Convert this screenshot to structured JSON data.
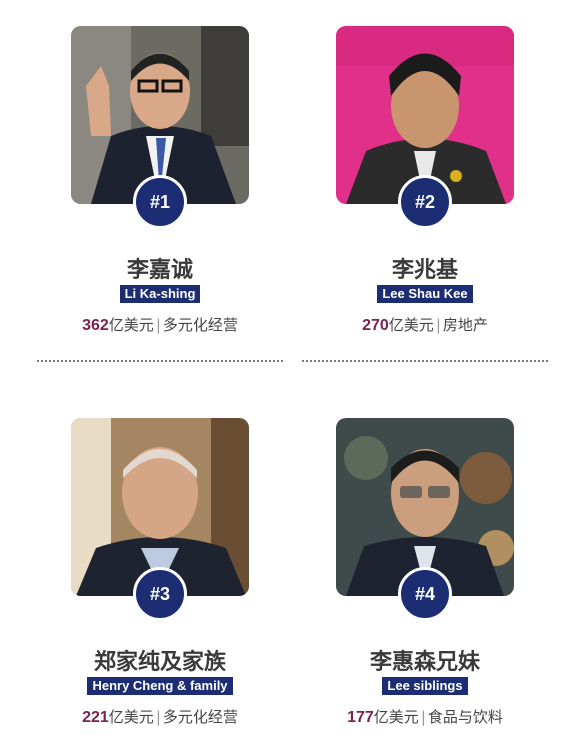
{
  "entries": [
    {
      "rank": "#1",
      "name_cn": "李嘉诚",
      "name_en": "Li Ka-shing",
      "amount": "362",
      "unit": "亿美元",
      "industry": "多元化经营"
    },
    {
      "rank": "#2",
      "name_cn": "李兆基",
      "name_en": "Lee Shau Kee",
      "amount": "270",
      "unit": "亿美元",
      "industry": "房地产"
    },
    {
      "rank": "#3",
      "name_cn": "郑家纯及家族",
      "name_en": "Henry Cheng & family",
      "amount": "221",
      "unit": "亿美元",
      "industry": "多元化经营"
    },
    {
      "rank": "#4",
      "name_cn": "李惠森兄妹",
      "name_en": "Lee siblings",
      "amount": "177",
      "unit": "亿美元",
      "industry": "食品与饮料"
    }
  ],
  "separator": "|",
  "colors": {
    "navy": "#1d2d73",
    "amount": "#7a2352",
    "name": "#3a3a3a"
  }
}
